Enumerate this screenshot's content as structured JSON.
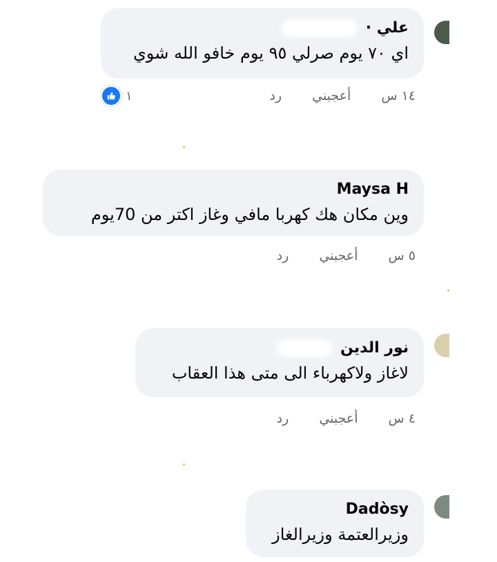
{
  "comments": [
    {
      "author": "علي ·",
      "text": "اي ٧٠ يوم صرلي ٩٥ يوم خافو الله شوي",
      "time": "١٤ س",
      "like_label": "أعجبني",
      "reply_label": "رد",
      "reaction_count": "١"
    },
    {
      "author": "Maysa H",
      "text": "وين مكان هك كهربا مافي وغاز اكتر من 70يوم",
      "time": "٥ س",
      "like_label": "أعجبني",
      "reply_label": "رد"
    },
    {
      "author": "نور الدين",
      "text": "لاغاز ولاكهرباء الى متى هذا العقاب",
      "time": "٤ س",
      "like_label": "أعجبني",
      "reply_label": "رد"
    },
    {
      "author": "Dadòsy",
      "text": "وزيرالعتمة وزيرالغاز"
    }
  ],
  "colors": {
    "bubble": "#f0f2f5",
    "meta": "#65676b",
    "like": "#1877f2"
  },
  "icons": {
    "reaction": "like-thumbs-up-icon"
  }
}
